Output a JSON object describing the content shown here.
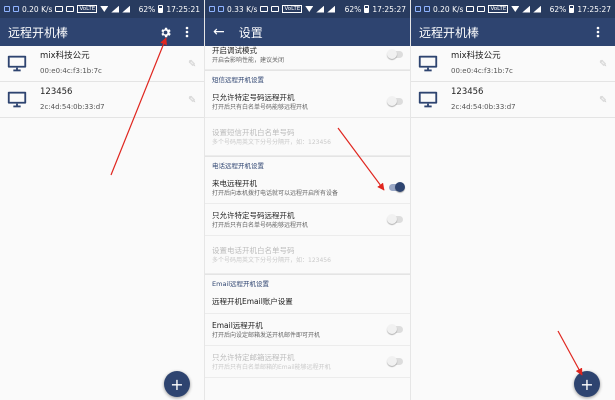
{
  "left": {
    "status": {
      "speed": "0.20 K/s",
      "battery": "62%",
      "time": "17:25:21",
      "vol_tag": "VoLTE"
    },
    "title": "远程开机棒",
    "devices": [
      {
        "name": "mix科技公元",
        "mac": "00:e0:4c:f3:1b:7c"
      },
      {
        "name": "123456",
        "mac": "2c:4d:54:0b:33:d7"
      }
    ],
    "fab": "+"
  },
  "middle": {
    "status": {
      "speed": "0.33 K/s",
      "battery": "62%",
      "time": "17:25:27",
      "vol_tag": "VoLTE"
    },
    "back": "←",
    "title": "设置",
    "top_item": {
      "title": "开启调试模式",
      "summary": "开启会影响性能，建议关闭"
    },
    "sms_header": "短信远程开机设置",
    "sms_only": {
      "title": "只允许特定号码远程开机",
      "summary": "打开后只有白名单号码能够远程开机"
    },
    "sms_whitelist": {
      "title": "设置短信开机白名单号码",
      "summary": "多个号码用英文下分号分隔开，如：123456"
    },
    "call_header": "电话远程开机设置",
    "call_wake": {
      "title": "来电远程开机",
      "summary": "打开后向本机拨打电话就可以远程开启所有设备"
    },
    "call_only": {
      "title": "只允许特定号码远程开机",
      "summary": "打开后只有白名单号码能够远程开机"
    },
    "call_whitelist": {
      "title": "设置电话开机白名单号码",
      "summary": "多个号码用英文下分号分隔开，如：123456"
    },
    "email_header": "Email远程开机设置",
    "email_account": {
      "title": "远程开机Email账户设置"
    },
    "email_wake": {
      "title": "Email远程开机",
      "summary": "打开后向设定邮箱发送开机邮件即可开机"
    },
    "email_only": {
      "title": "只允许特定邮箱远程开机",
      "summary": "打开后只有白名单邮箱的Email能够远程开机"
    }
  },
  "right": {
    "status": {
      "speed": "0.20 K/s",
      "battery": "62%",
      "time": "17:25:27",
      "vol_tag": "VoLTE"
    },
    "title": "远程开机棒",
    "devices": [
      {
        "name": "mix科技公元",
        "mac": "00:e0:4c:f3:1b:7c"
      },
      {
        "name": "123456",
        "mac": "2c:4d:54:0b:33:d7"
      }
    ],
    "fab": "+"
  },
  "colors": {
    "appbar": "#2e4470",
    "statusbar": "#283b5f",
    "annotation_arrow": "#e0261f"
  },
  "icons": [
    "gear-icon",
    "more-vert-icon",
    "back-arrow-icon",
    "computer-icon",
    "edit-icon",
    "plus-icon"
  ]
}
